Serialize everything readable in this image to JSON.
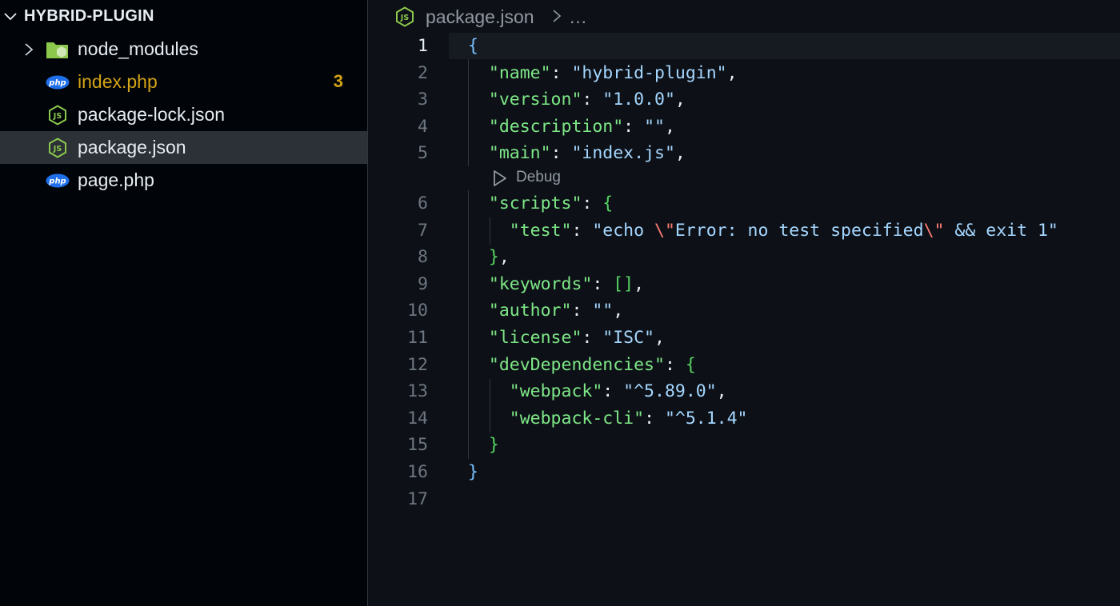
{
  "explorer": {
    "title": "HYBRID-PLUGIN",
    "items": [
      {
        "name": "node_modules",
        "type": "folder",
        "icon": "node-folder-icon"
      },
      {
        "name": "index.php",
        "type": "php",
        "icon": "php-file-icon",
        "modified": true,
        "badge": "3"
      },
      {
        "name": "package-lock.json",
        "type": "json",
        "icon": "nodejs-file-icon"
      },
      {
        "name": "package.json",
        "type": "json",
        "icon": "nodejs-file-icon",
        "selected": true
      },
      {
        "name": "page.php",
        "type": "php",
        "icon": "php-file-icon"
      }
    ]
  },
  "breadcrumb": {
    "file": "package.json",
    "more": "…"
  },
  "editor": {
    "active_line": 1,
    "codelens": "Debug",
    "line_numbers": [
      "1",
      "2",
      "3",
      "4",
      "5",
      "6",
      "7",
      "8",
      "9",
      "10",
      "11",
      "12",
      "13",
      "14",
      "15",
      "16",
      "17"
    ]
  },
  "colors": {
    "key": "#7ee787",
    "string": "#a5d6ff",
    "escape": "#ff7b72",
    "modified": "#d3a417",
    "php_icon": "#1f6feb",
    "node_green": "#8cc84b"
  }
}
